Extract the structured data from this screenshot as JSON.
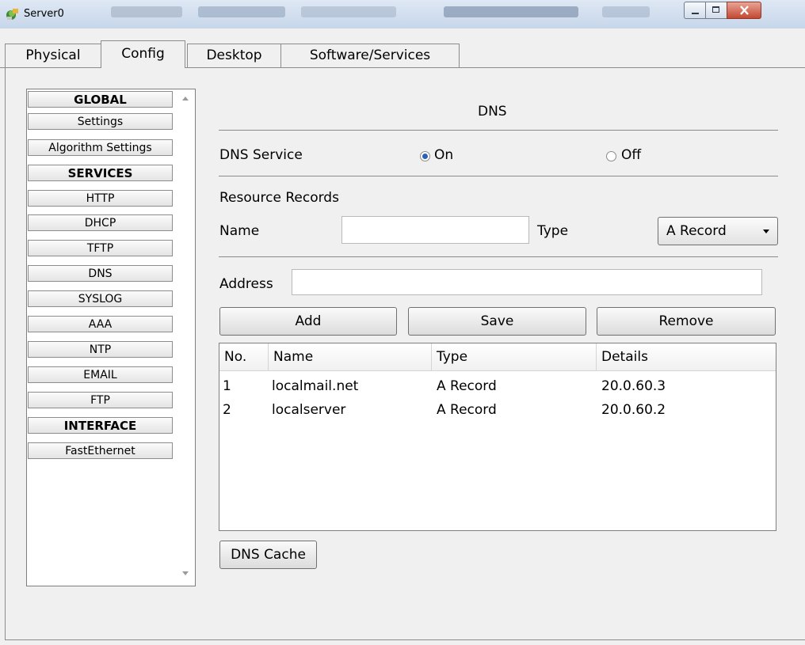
{
  "window": {
    "title": "Server0"
  },
  "tabs": [
    {
      "label": "Physical"
    },
    {
      "label": "Config"
    },
    {
      "label": "Desktop"
    },
    {
      "label": "Software/Services"
    }
  ],
  "nav": {
    "items": [
      {
        "label": "GLOBAL"
      },
      {
        "label": "Settings"
      },
      {
        "label": "Algorithm Settings"
      },
      {
        "label": "SERVICES"
      },
      {
        "label": "HTTP"
      },
      {
        "label": "DHCP"
      },
      {
        "label": "TFTP"
      },
      {
        "label": "DNS"
      },
      {
        "label": "SYSLOG"
      },
      {
        "label": "AAA"
      },
      {
        "label": "NTP"
      },
      {
        "label": "EMAIL"
      },
      {
        "label": "FTP"
      },
      {
        "label": "INTERFACE"
      },
      {
        "label": "FastEthernet"
      }
    ]
  },
  "dns": {
    "title": "DNS",
    "service_label": "DNS Service",
    "on_label": "On",
    "off_label": "Off",
    "service_state": "On",
    "resource_records_label": "Resource Records",
    "name_label": "Name",
    "name_value": "",
    "type_label": "Type",
    "type_selected": "A Record",
    "address_label": "Address",
    "address_value": "",
    "add_label": "Add",
    "save_label": "Save",
    "remove_label": "Remove",
    "cache_label": "DNS Cache"
  },
  "table": {
    "columns": [
      "No.",
      "Name",
      "Type",
      "Details"
    ],
    "rows": [
      [
        "1",
        "localmail.net",
        "A Record",
        "20.0.60.3"
      ],
      [
        "2",
        "localserver",
        "A Record",
        "20.0.60.2"
      ]
    ]
  }
}
